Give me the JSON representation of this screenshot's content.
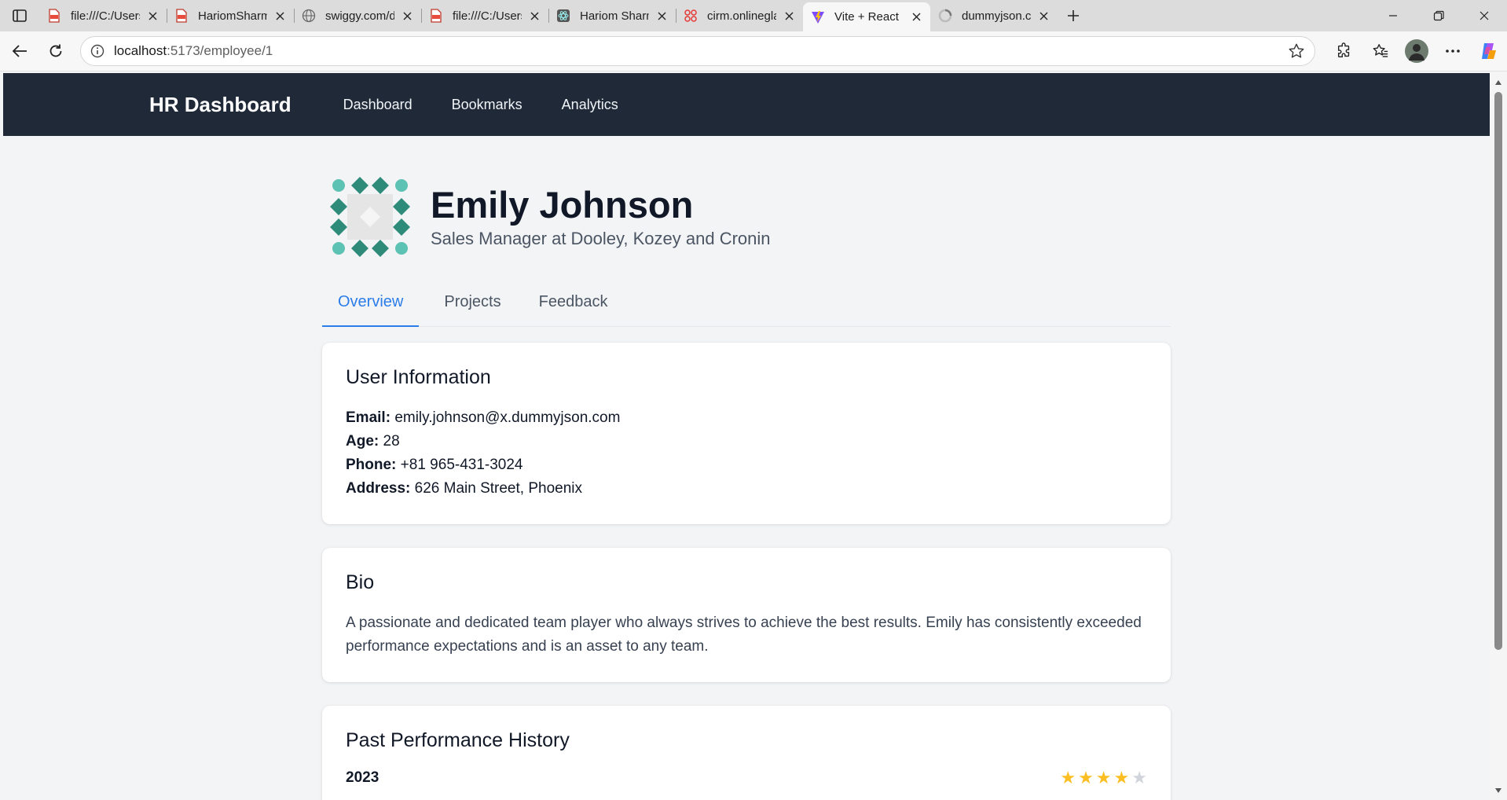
{
  "browser": {
    "tabs": [
      {
        "title": "file:///C:/Users/Ha",
        "icon": "pdf-icon",
        "active": false
      },
      {
        "title": "HariomSharmaRes",
        "icon": "pdf-icon",
        "active": false
      },
      {
        "title": "swiggy.com/dapi/",
        "icon": "globe-icon",
        "active": false
      },
      {
        "title": "file:///C:/Users/Ha",
        "icon": "pdf-icon",
        "active": false
      },
      {
        "title": "Hariom Sharma || I",
        "icon": "react-icon",
        "active": false
      },
      {
        "title": "cirm.onlinegla.com",
        "icon": "gla-icon",
        "active": false
      },
      {
        "title": "Vite + React",
        "icon": "vite-icon",
        "active": true
      },
      {
        "title": "dummyjson.com/u",
        "icon": "loading-icon",
        "active": false
      }
    ],
    "url_host": "localhost",
    "url_rest": ":5173/employee/1"
  },
  "app": {
    "brand": "HR Dashboard",
    "nav": [
      "Dashboard",
      "Bookmarks",
      "Analytics"
    ]
  },
  "profile": {
    "name": "Emily Johnson",
    "subtitle": "Sales Manager at Dooley, Kozey and Cronin",
    "tabs": [
      "Overview",
      "Projects",
      "Feedback"
    ],
    "active_tab": "Overview"
  },
  "user_info": {
    "heading": "User Information",
    "email_label": "Email:",
    "email": "emily.johnson@x.dummyjson.com",
    "age_label": "Age:",
    "age": "28",
    "phone_label": "Phone:",
    "phone": "+81 965-431-3024",
    "address_label": "Address:",
    "address": "626 Main Street, Phoenix"
  },
  "bio": {
    "heading": "Bio",
    "text": "A passionate and dedicated team player who always strives to achieve the best results. Emily has consistently exceeded performance expectations and is an asset to any team."
  },
  "performance": {
    "heading": "Past Performance History",
    "entries": [
      {
        "year": "2023",
        "rating": 4,
        "max": 5
      }
    ]
  },
  "colors": {
    "nav_bg": "#1f2937",
    "accent": "#2b7de9",
    "star_filled": "#fbbf24",
    "star_empty": "#d1d5db",
    "identicon_dark": "#2e8b7a",
    "identicon_light": "#5cc2b3"
  }
}
